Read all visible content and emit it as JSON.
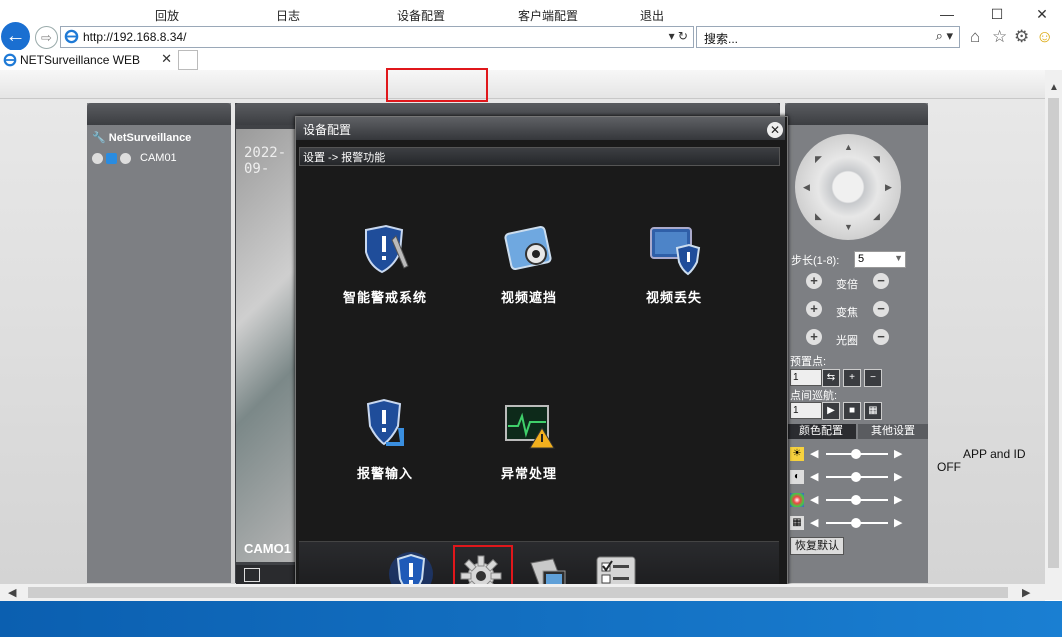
{
  "browser": {
    "url": "http://192.168.8.34/",
    "search_placeholder": "搜索...",
    "tab_title": "NETSurveillance WEB",
    "back_icon": "←",
    "forward_icon": "⇨",
    "min_icon": "—",
    "max_icon": "☐",
    "close_icon": "✕",
    "home_icon": "⌂",
    "star_icon": "☆",
    "gear_icon": "⚙",
    "smile_icon": "☺",
    "tab_close": "✕",
    "addr_tools": "▾ ↻",
    "search_tools": "⌕ ▾"
  },
  "menu": {
    "items": [
      "回放",
      "日志",
      "设备配置",
      "客户端配置",
      "退出"
    ],
    "highlighted": "设备配置"
  },
  "left_panel": {
    "root": "NetSurveillance",
    "camera": "CAM01"
  },
  "video": {
    "timestamp": "2022-09-",
    "cam_label": "CAMO1"
  },
  "ptz": {
    "step_label": "步长(1-8):",
    "step_value": "5",
    "zoom_label": "变倍",
    "focus_label": "变焦",
    "iris_label": "光圈",
    "plus": "+",
    "minus": "−",
    "preset_label": "预置点:",
    "preset_value": "1",
    "cruise_label": "点间巡航:",
    "cruise_value": "1",
    "color_tab": "颜色配置",
    "other_tab": "其他设置",
    "restore": "恢复默认"
  },
  "side_text": {
    "line1": "APP and ID",
    "line2": "OFF"
  },
  "dialog": {
    "title": "设备配置",
    "close": "✕",
    "breadcrumb": "设置 -> 报警功能",
    "features": [
      {
        "label": "智能警戒系统",
        "icon": "shield-wrench-icon"
      },
      {
        "label": "视频遮挡",
        "icon": "camera-cover-icon"
      },
      {
        "label": "视频丢失",
        "icon": "monitor-shield-icon"
      },
      {
        "label": "报警输入",
        "icon": "shield-input-icon"
      },
      {
        "label": "异常处理",
        "icon": "warning-chart-icon"
      }
    ],
    "dock": [
      {
        "icon": "shield-icon"
      },
      {
        "icon": "gear-icon",
        "highlighted": true
      },
      {
        "icon": "tools-icon"
      },
      {
        "icon": "checklist-icon"
      }
    ]
  },
  "colors": {
    "highlight": "#e0171b",
    "accent_blue": "#2a8ce0"
  }
}
